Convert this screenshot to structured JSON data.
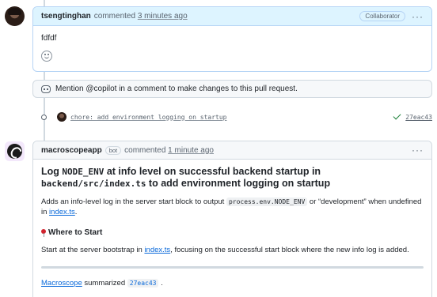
{
  "comment1": {
    "author": "tsengtinghan",
    "action": "commented",
    "time": "3 minutes ago",
    "role_badge": "Collaborator",
    "body": "fdfdf"
  },
  "copilot_tip": {
    "text": "Mention @copilot in a comment to make changes to this pull request."
  },
  "commit": {
    "message": "chore: add environment logging on startup",
    "sha": "27eac43"
  },
  "comment2": {
    "author": "macroscopeapp",
    "bot_badge": "bot",
    "action": "commented",
    "time": "1 minute ago",
    "title_pre": "Log ",
    "title_code1": "NODE_ENV",
    "title_mid": " at info level on successful backend startup in ",
    "title_code2": "backend/src/index.ts",
    "title_post": " to add environment logging on startup",
    "para1_pre": "Adds an info-level log in the server start block to output ",
    "para1_code": "process.env.NODE_ENV",
    "para1_mid": " or “development” when undefined in ",
    "para1_link": "index.ts",
    "para1_post": ".",
    "heading": "Where to Start",
    "para2_pre": "Start at the server bootstrap in ",
    "para2_link": "index.ts",
    "para2_post": ", focusing on the successful start block where the new info log is added.",
    "summary_link": "Macroscope",
    "summary_mid": " summarized ",
    "summary_sha": "27eac43",
    "summary_post": " ."
  },
  "colors": {
    "accent": "#0969da",
    "header_blue": "#ddf4ff",
    "success": "#1a7f37"
  }
}
